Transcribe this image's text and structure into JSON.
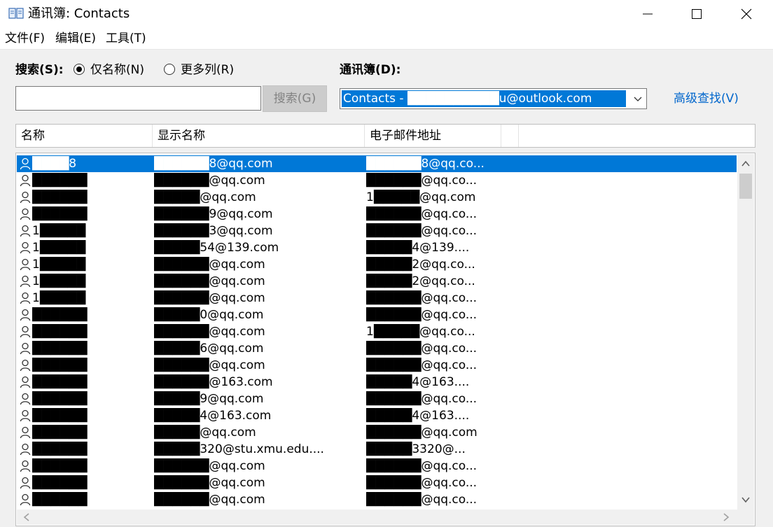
{
  "window": {
    "title": "通讯簿: Contacts",
    "icon": "address-book-icon",
    "controls": [
      "minimize-icon",
      "maximize-icon",
      "close-icon"
    ]
  },
  "menu": [
    {
      "label": "文件(F)"
    },
    {
      "label": "编辑(E)"
    },
    {
      "label": "工具(T)"
    }
  ],
  "search": {
    "label": "搜索(S):",
    "radio_name_only": "仅名称(N)",
    "radio_more_cols": "更多列(R)",
    "selected_option": "仅名称(N)",
    "input_value": "",
    "button": "搜索(G)"
  },
  "address_book": {
    "label": "通讯簿(D):",
    "selected": "Contacts - ██████████u@outlook.com",
    "advanced_find": "高级查找(V)"
  },
  "columns": [
    "名称",
    "显示名称",
    "电子邮件地址"
  ],
  "rows": [
    {
      "name": "████8",
      "display": "██████8@qq.com",
      "email": "██████8@qq.co...",
      "selected": true
    },
    {
      "name": "██████",
      "display": "██████@qq.com",
      "email": "██████@qq.co...",
      "selected": false
    },
    {
      "name": "██████",
      "display": "█████@qq.com",
      "email": "1█████@qq.com",
      "selected": false
    },
    {
      "name": "██████",
      "display": "██████9@qq.com",
      "email": "██████@qq.co...",
      "selected": false
    },
    {
      "name": "1█████",
      "display": "██████3@qq.com",
      "email": "██████@qq.co...",
      "selected": false
    },
    {
      "name": "1█████",
      "display": "█████54@139.com",
      "email": "█████4@139....",
      "selected": false
    },
    {
      "name": "1█████",
      "display": "██████@qq.com",
      "email": "█████2@qq.co...",
      "selected": false
    },
    {
      "name": "1█████",
      "display": "██████@qq.com",
      "email": "█████2@qq.co...",
      "selected": false
    },
    {
      "name": "1█████",
      "display": "██████@qq.com",
      "email": "██████@qq.co...",
      "selected": false
    },
    {
      "name": "██████",
      "display": "█████0@qq.com",
      "email": "██████@qq.co...",
      "selected": false
    },
    {
      "name": "██████",
      "display": "██████@qq.com",
      "email": "1█████@qq.co...",
      "selected": false
    },
    {
      "name": "██████",
      "display": "█████6@qq.com",
      "email": "██████@qq.co...",
      "selected": false
    },
    {
      "name": "██████",
      "display": "██████@qq.com",
      "email": "██████@qq.co...",
      "selected": false
    },
    {
      "name": "██████",
      "display": "██████@163.com",
      "email": "█████4@163....",
      "selected": false
    },
    {
      "name": "██████",
      "display": "█████9@qq.com",
      "email": "██████@qq.co...",
      "selected": false
    },
    {
      "name": "██████",
      "display": "█████4@163.com",
      "email": "█████4@163....",
      "selected": false
    },
    {
      "name": "██████",
      "display": "█████@qq.com",
      "email": "██████@qq.com",
      "selected": false
    },
    {
      "name": "██████",
      "display": "█████320@stu.xmu.edu....",
      "email": "█████3320@...",
      "selected": false
    },
    {
      "name": "██████",
      "display": "██████@qq.com",
      "email": "██████@qq.co...",
      "selected": false
    },
    {
      "name": "██████",
      "display": "██████@qq.com",
      "email": "██████@qq.co...",
      "selected": false
    },
    {
      "name": "██████",
      "display": "██████@qq.com",
      "email": "██████@qq.co...",
      "selected": false
    }
  ]
}
